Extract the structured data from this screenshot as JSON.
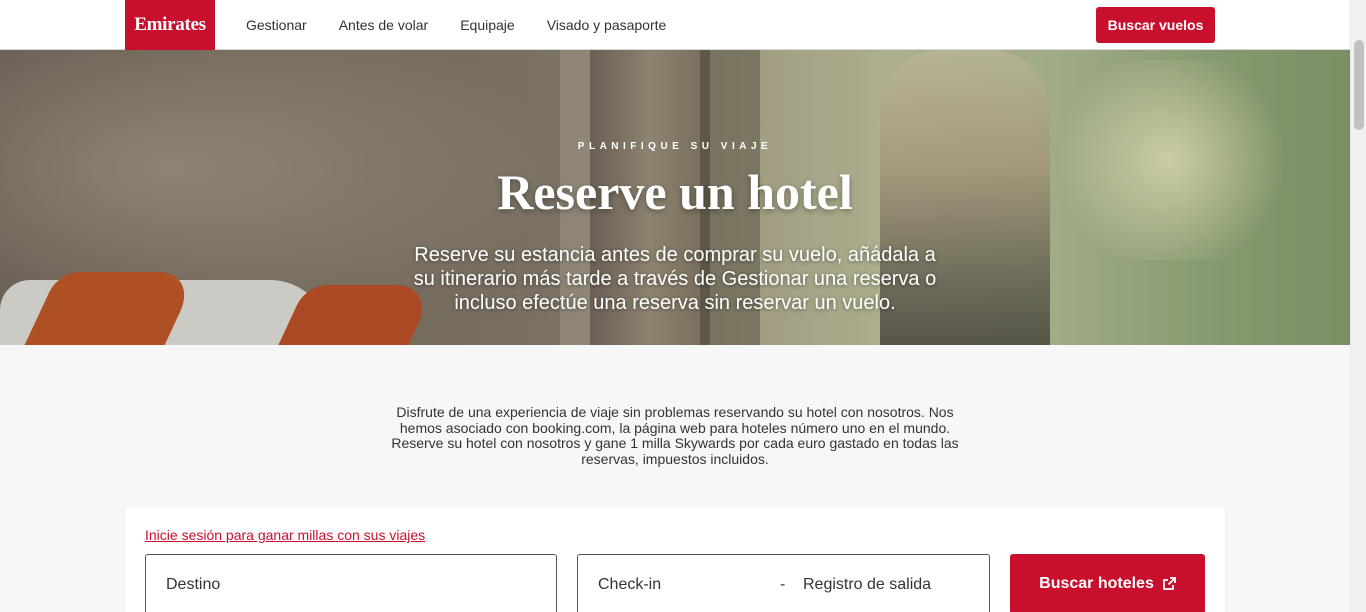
{
  "header": {
    "logo": "Emirates",
    "nav": [
      "Gestionar",
      "Antes de volar",
      "Equipaje",
      "Visado y pasaporte"
    ],
    "cta": "Buscar vuelos"
  },
  "hero": {
    "eyebrow": "PLANIFIQUE SU VIAJE",
    "title": "Reserve un hotel",
    "subtitle": "Reserve su estancia antes de comprar su vuelo, añádala a su itinerario más tarde a través de Gestionar una reserva o incluso efectúe una reserva sin reservar un vuelo."
  },
  "intro": {
    "text": "Disfrute de una experiencia de viaje sin problemas reservando su hotel con nosotros. Nos hemos asociado con booking.com, la página web para hoteles número uno en el mundo. Reserve su hotel con nosotros y gane 1 milla Skywards por cada euro gastado en todas las reservas, impuestos incluidos."
  },
  "search": {
    "login_link": "Inicie sesión para ganar millas con sus viajes",
    "destination_placeholder": "Destino",
    "checkin_label": "Check-in",
    "separator": "-",
    "checkout_label": "Registro de salida",
    "submit_label": "Buscar hoteles",
    "submit_icon": "external-link-icon"
  },
  "colors": {
    "brand": "#c8102e",
    "background": "#f7f7f7"
  }
}
